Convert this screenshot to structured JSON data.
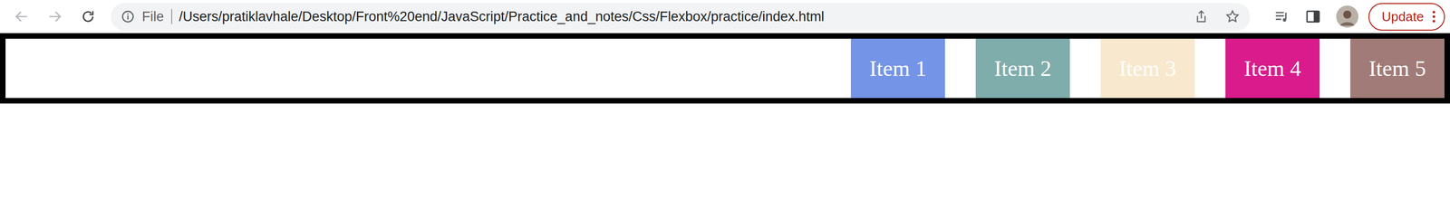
{
  "browser": {
    "back_enabled": false,
    "forward_enabled": false,
    "address_bar": {
      "scheme_label": "File",
      "url": "/Users/pratiklavhale/Desktop/Front%20end/JavaScript/Practice_and_notes/Css/Flexbox/practice/index.html"
    },
    "update_button": {
      "label": "Update"
    }
  },
  "flex_container": {
    "items": [
      {
        "label": "Item 1",
        "color": "#7494e7"
      },
      {
        "label": "Item 2",
        "color": "#7fadab"
      },
      {
        "label": "Item 3",
        "color": "#f8e8cd"
      },
      {
        "label": "Item 4",
        "color": "#d91b8c"
      },
      {
        "label": "Item 5",
        "color": "#a07b77"
      }
    ]
  }
}
